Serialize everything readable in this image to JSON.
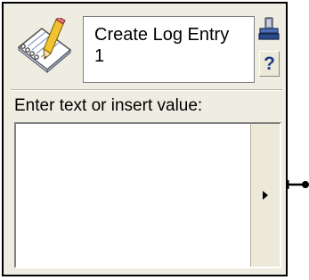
{
  "activity": {
    "title": "Create Log Entry\n1",
    "icon": "notebook-pencil-icon"
  },
  "header": {
    "lock_icon": "lock-icon",
    "help_label": "?"
  },
  "editor": {
    "prompt_label": "Enter text or insert value:",
    "text_value": "",
    "insert_button_icon": "right-arrow-icon"
  },
  "colors": {
    "panel_background": "#efede1",
    "panel_border": "#000000",
    "help_accent": "#1f3a8a"
  }
}
